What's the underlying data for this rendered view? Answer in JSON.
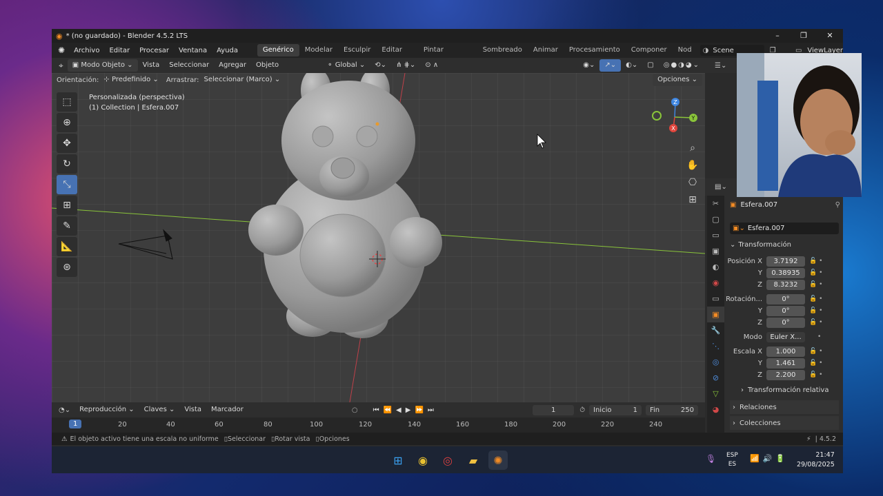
{
  "window": {
    "title": "* (no guardado) - Blender 4.5.2 LTS",
    "minimize": "–",
    "maximize": "❐",
    "close": "✕"
  },
  "menu": [
    "Archivo",
    "Editar",
    "Procesar",
    "Ventana",
    "Ayuda"
  ],
  "workspaces": [
    "Genérico",
    "Modelar",
    "Esculpir",
    "Editar UV",
    "Pintar texturas",
    "Sombreado",
    "Animar",
    "Procesamiento",
    "Componer",
    "Nod"
  ],
  "scene": "Scene",
  "viewlayer": "ViewLayer",
  "header3d": {
    "mode": "Modo Objeto",
    "vista": "Vista",
    "seleccionar": "Seleccionar",
    "agregar": "Agregar",
    "objeto": "Objeto",
    "transform": "Global"
  },
  "toolsettings": {
    "orientacion_label": "Orientación:",
    "orientacion_value": "Predefinido",
    "arrastrar_label": "Arrastrar:",
    "arrastrar_value": "Seleccionar (Marco)",
    "opciones": "Opciones"
  },
  "viewport_info": {
    "line1": "Personalizada (perspectiva)",
    "line2": "(1) Collection | Esfera.007"
  },
  "gizmo": {
    "x": "X",
    "y": "Y",
    "z": "Z"
  },
  "timeline": {
    "reproduccion": "Reproducción",
    "claves": "Claves",
    "vista": "Vista",
    "marcador": "Marcador",
    "current_frame": "1",
    "inicio_label": "Inicio",
    "inicio": "1",
    "fin_label": "Fin",
    "fin": "250"
  },
  "ruler": {
    "current": "1",
    "ticks": [
      "20",
      "40",
      "60",
      "80",
      "100",
      "120",
      "140",
      "160",
      "180",
      "200",
      "220",
      "240"
    ]
  },
  "statusbar": {
    "warning": "El objeto activo tiene una escala no uniforme",
    "seleccionar": "Seleccionar",
    "rotar": "Rotar vista",
    "opciones": "Opciones",
    "version": "4.5.2"
  },
  "properties": {
    "object_name": "Esfera.007",
    "data_name": "Esfera.007",
    "transform_header": "Transformación",
    "position": {
      "label_x": "Posición X",
      "x": "3.7192",
      "y": "0.38935",
      "z": "8.3232"
    },
    "rotation": {
      "label_x": "Rotación...",
      "x": "0°",
      "y": "0°",
      "z": "0°"
    },
    "mode": {
      "label": "Modo",
      "value": "Euler X..."
    },
    "scale": {
      "label_x": "Escala X",
      "x": "1.000",
      "y": "1.461",
      "z": "2.200"
    },
    "label_y": "Y",
    "label_z": "Z",
    "relative": "Transformación relativa",
    "relaciones": "Relaciones",
    "colecciones": "Colecciones"
  },
  "taskbar": {
    "lang1": "ESP",
    "lang2": "ES",
    "time": "21:47",
    "date": "29/08/2025"
  },
  "colors": {
    "accent": "#4772b3",
    "x_axis": "#e0453c",
    "y_axis": "#8ac53a",
    "z_axis": "#3f86e0"
  }
}
